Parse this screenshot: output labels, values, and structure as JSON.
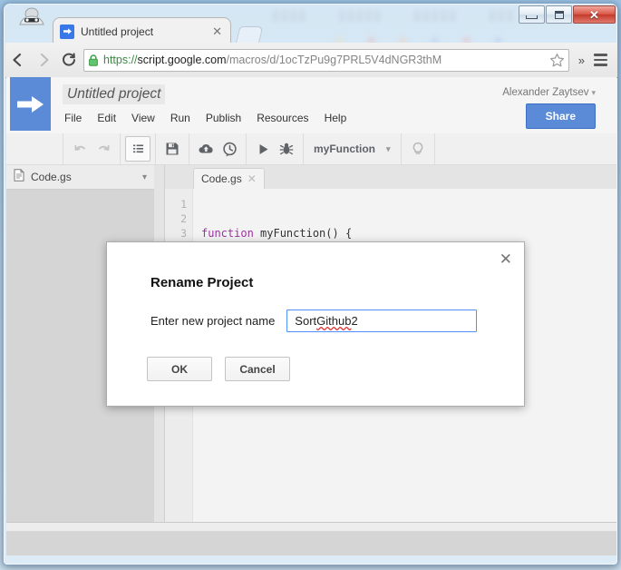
{
  "window": {
    "minimize_label": "Minimize",
    "maximize_label": "Maximize",
    "close_label": "✕"
  },
  "browser": {
    "incognito_icon": "incognito-icon",
    "tab": {
      "title": "Untitled project",
      "favicon": "apps-script-arrow-icon",
      "close_label": "✕"
    },
    "new_tab_label": "",
    "back_label": "←",
    "forward_label": "→",
    "reload_label": "C",
    "omnibox": {
      "lock_icon": "lock-icon",
      "scheme": "https://",
      "host": "script.google.com",
      "path": "/macros/d/1ocTzPu9g7PRL5V4dNGR3thM",
      "full_url": "https://script.google.com/macros/d/1ocTzPu9g7PRL5V4dNGR3thM",
      "star_icon": "bookmark-star-icon",
      "overflow_label": "»",
      "menu_icon": "hamburger-menu-icon"
    }
  },
  "app": {
    "logo_icon": "apps-script-arrow-logo",
    "project_title": "Untitled project",
    "menu": [
      "File",
      "Edit",
      "View",
      "Run",
      "Publish",
      "Resources",
      "Help"
    ],
    "user_name": "Alexander Zaytsev",
    "user_caret": "▾",
    "share_label": "Share",
    "toolbar": {
      "undo_icon": "undo-icon",
      "redo_icon": "redo-icon",
      "indent_icon": "indent-list-icon",
      "save_icon": "save-floppy-icon",
      "publish_icon": "cloud-icon",
      "history_icon": "clock-history-icon",
      "run_icon": "run-play-icon",
      "debug_icon": "debug-bug-icon",
      "function_name": "myFunction",
      "function_caret": "▾",
      "hint_icon": "lightbulb-icon"
    }
  },
  "sidebar": {
    "file_icon": "file-document-icon",
    "file_name": "Code.gs",
    "caret": "▾"
  },
  "editor": {
    "tab_label": "Code.gs",
    "tab_close": "✕",
    "line_numbers": [
      "1",
      "2",
      "3"
    ],
    "code_lines": [
      {
        "keyword": "function",
        "rest": " myFunction() {"
      },
      {
        "keyword": "",
        "rest": ""
      },
      {
        "keyword": "",
        "rest": "}"
      }
    ]
  },
  "dialog": {
    "close_icon": "close-icon",
    "close_label": "✕",
    "title": "Rename Project",
    "field_label": "Enter new project name",
    "input_value_prefix": "Sort ",
    "input_value_misspelled": "Github",
    "input_value_suffix": " 2",
    "input_value": "Sort Github 2",
    "input_placeholder": "",
    "ok_label": "OK",
    "cancel_label": "Cancel"
  },
  "colors": {
    "brand_blue": "#5b8ad6",
    "input_focus_border": "#4d90fe",
    "spellcheck_red": "#e03030",
    "keyword_purple": "#9b30a0",
    "close_button_red": "#c23a2c"
  }
}
